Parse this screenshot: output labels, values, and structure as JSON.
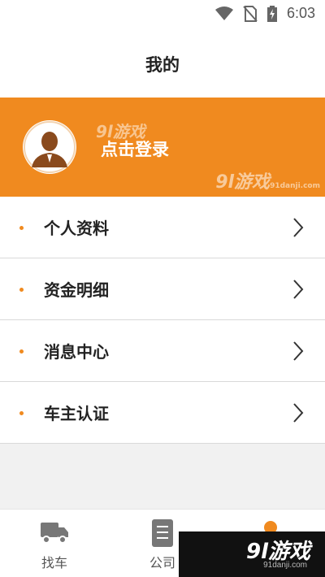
{
  "statusbar": {
    "time": "6:03",
    "icons": [
      "wifi-icon",
      "no-sim-icon",
      "battery-charging-icon"
    ]
  },
  "header": {
    "title": "我的"
  },
  "profile": {
    "login_label": "点击登录",
    "watermark_small": "9l游戏",
    "watermark_big": "9l游戏",
    "watermark_big_sub": "91danji.com"
  },
  "menu": {
    "items": [
      {
        "label": "个人资料"
      },
      {
        "label": "资金明细"
      },
      {
        "label": "消息中心"
      },
      {
        "label": "车主认证"
      }
    ]
  },
  "tabbar": {
    "tabs": [
      {
        "label": "找车",
        "icon": "truck-icon"
      },
      {
        "label": "公司",
        "icon": "document-icon"
      },
      {
        "label": "",
        "icon": "profile-icon"
      }
    ]
  },
  "overlay": {
    "text": "9l游戏",
    "sub": "91danji.com"
  },
  "colors": {
    "accent": "#f08a1f",
    "background": "#f1f1f1"
  }
}
